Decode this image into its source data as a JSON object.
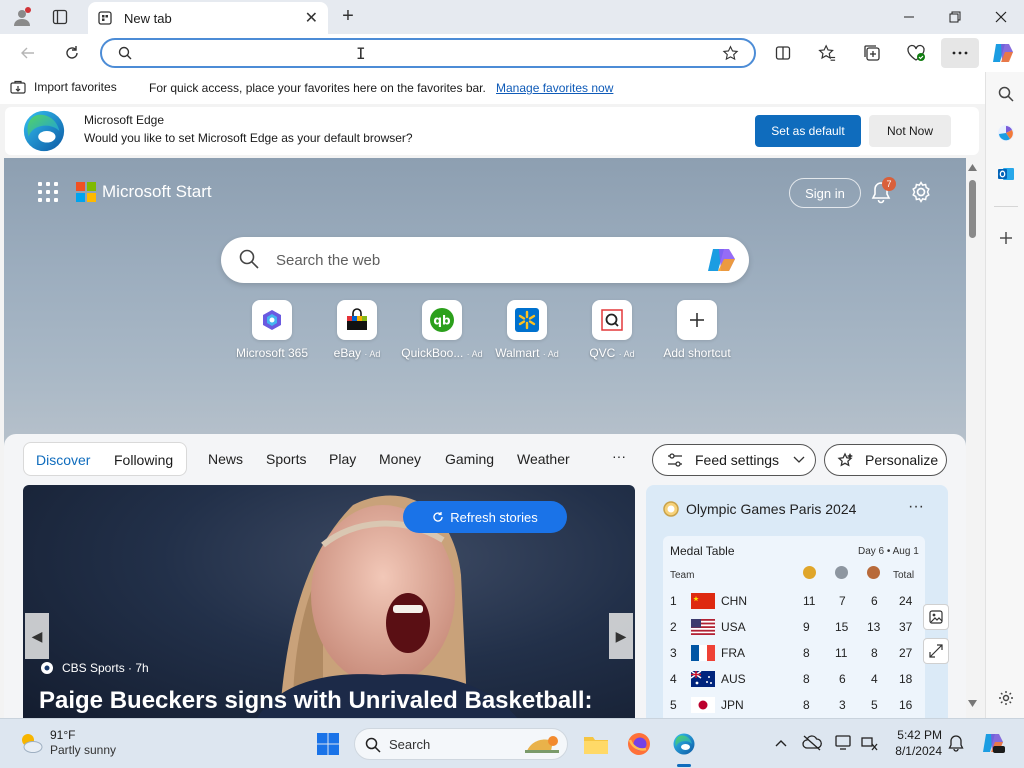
{
  "browser": {
    "tab_title": "New tab",
    "address_placeholder": "",
    "colors": {
      "accent": "#0f6cbd",
      "titlebar": "#e6eaf0"
    }
  },
  "favorites_bar": {
    "import_label": "Import favorites",
    "message": "For quick access, place your favorites here on the favorites bar.",
    "manage_link": "Manage favorites now"
  },
  "default_banner": {
    "title": "Microsoft Edge",
    "description": "Would you like to set Microsoft Edge as your default browser?",
    "primary": "Set as default",
    "secondary": "Not Now"
  },
  "start": {
    "brand": "Microsoft Start",
    "sign_in": "Sign in",
    "notification_count": "7",
    "search_placeholder": "Search the web",
    "shortcuts": [
      {
        "label": "Microsoft 365",
        "ad": "",
        "icon": "microsoft-365-icon"
      },
      {
        "label": "eBay",
        "ad": "· Ad",
        "icon": "ebay-icon"
      },
      {
        "label": "QuickBoo...",
        "ad": "· Ad",
        "icon": "quickbooks-icon"
      },
      {
        "label": "Walmart",
        "ad": "· Ad",
        "icon": "walmart-icon"
      },
      {
        "label": "QVC",
        "ad": "· Ad",
        "icon": "qvc-icon"
      },
      {
        "label": "Add shortcut",
        "ad": "",
        "icon": "plus-icon"
      }
    ]
  },
  "feed": {
    "pills": [
      "Discover",
      "Following"
    ],
    "tabs": [
      "News",
      "Sports",
      "Play",
      "Money",
      "Gaming",
      "Weather"
    ],
    "more": "···",
    "feed_settings": "Feed settings",
    "personalize": "Personalize",
    "refresh": "Refresh stories",
    "hero": {
      "source": "CBS Sports · 7h",
      "title": "Paige Bueckers signs with Unrivaled Basketball:"
    },
    "olympics": {
      "title": "Olympic Games Paris 2024",
      "more": "···",
      "table_title": "Medal Table",
      "date": "Day 6 • Aug 1",
      "header_team": "Team",
      "header_total": "Total",
      "rows": [
        {
          "rank": "1",
          "team": "CHN",
          "gold": "11",
          "silver": "7",
          "bronze": "6",
          "total": "24",
          "flag": "china"
        },
        {
          "rank": "2",
          "team": "USA",
          "gold": "9",
          "silver": "15",
          "bronze": "13",
          "total": "37",
          "flag": "usa"
        },
        {
          "rank": "3",
          "team": "FRA",
          "gold": "8",
          "silver": "11",
          "bronze": "8",
          "total": "27",
          "flag": "france"
        },
        {
          "rank": "4",
          "team": "AUS",
          "gold": "8",
          "silver": "6",
          "bronze": "4",
          "total": "18",
          "flag": "australia"
        },
        {
          "rank": "5",
          "team": "JPN",
          "gold": "8",
          "silver": "3",
          "bronze": "5",
          "total": "16",
          "flag": "japan"
        }
      ]
    }
  },
  "taskbar": {
    "weather_temp": "91°F",
    "weather_cond": "Partly sunny",
    "search_label": "Search",
    "time": "5:42 PM",
    "date": "8/1/2024"
  }
}
